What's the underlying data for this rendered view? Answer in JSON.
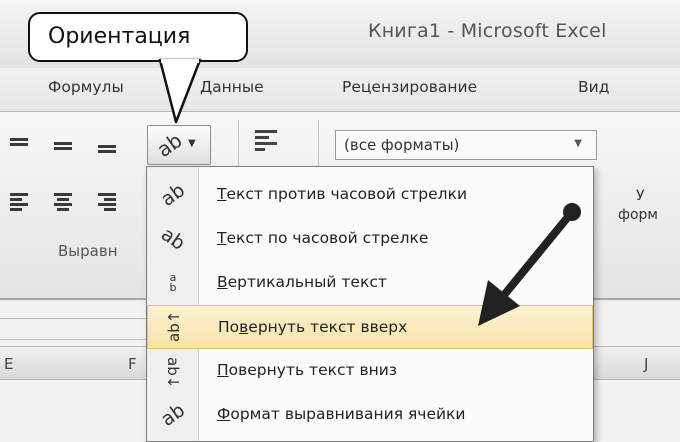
{
  "callout": {
    "text": "Ориентация"
  },
  "window": {
    "title": "Книга1 - Microsoft Excel"
  },
  "tabs": [
    {
      "label": "Формулы"
    },
    {
      "label": "Данные"
    },
    {
      "label": "Рецензирование"
    },
    {
      "label": "Вид"
    }
  ],
  "ribbon": {
    "orientation_icon": "text-orientation-icon",
    "wrap_icon": "wrap-text-icon",
    "number_format": {
      "value": "(все форматы)"
    },
    "alignment_group_label": "Выравн",
    "side_mark": "У",
    "side_label": "форм"
  },
  "sheet": {
    "column_headers": [
      "E",
      "F",
      "J"
    ]
  },
  "menu": {
    "items": [
      {
        "label_acc": "Т",
        "label_rest": "екст против часовой стрелки",
        "icon": "rotate-counterclockwise-icon"
      },
      {
        "label_acc": "Т",
        "label_rest": "екст по часовой стрелке",
        "icon": "rotate-clockwise-icon"
      },
      {
        "label_acc": "В",
        "label_rest": "ертикальный текст",
        "icon": "vertical-text-icon"
      },
      {
        "label_pre": "По",
        "label_acc": "в",
        "label_rest": "ернуть текст вверх",
        "icon": "rotate-text-up-icon",
        "highlighted": true
      },
      {
        "label_acc": "П",
        "label_rest": "овернуть текст вниз",
        "icon": "rotate-text-down-icon"
      },
      {
        "label_acc": "Ф",
        "label_rest": "ормат выравнивания ячейки",
        "icon": "format-cell-alignment-icon"
      }
    ]
  },
  "colors": {
    "highlight": "#f7e4a9",
    "highlight_border": "#e3c36f",
    "arrow": "#222222"
  }
}
